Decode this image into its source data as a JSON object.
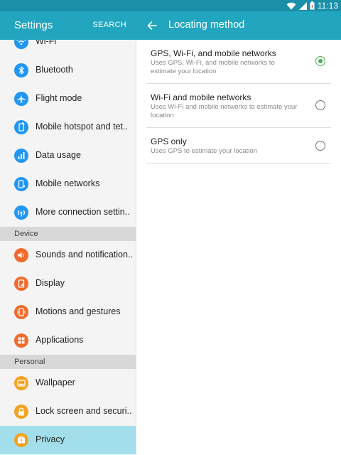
{
  "status_bar": {
    "time": "11:13"
  },
  "left_header": {
    "title": "Settings",
    "search_label": "SEARCH"
  },
  "right_header": {
    "title": "Locating method"
  },
  "settings_list": [
    {
      "type": "item",
      "label": "Wi-Fi",
      "icon": "wifi-icon",
      "color": "#2196f3"
    },
    {
      "type": "item",
      "label": "Bluetooth",
      "icon": "bluetooth-icon",
      "color": "#2196f3"
    },
    {
      "type": "item",
      "label": "Flight mode",
      "icon": "airplane-icon",
      "color": "#2196f3"
    },
    {
      "type": "item",
      "label": "Mobile hotspot and tet..",
      "icon": "hotspot-icon",
      "color": "#2196f3"
    },
    {
      "type": "item",
      "label": "Data usage",
      "icon": "data-usage-icon",
      "color": "#2196f3"
    },
    {
      "type": "item",
      "label": "Mobile networks",
      "icon": "mobile-networks-icon",
      "color": "#2196f3"
    },
    {
      "type": "item",
      "label": "More connection settin..",
      "icon": "more-connections-icon",
      "color": "#2196f3"
    },
    {
      "type": "header",
      "label": "Device"
    },
    {
      "type": "item",
      "label": "Sounds and notification..",
      "icon": "sound-icon",
      "color": "#ef6c2e"
    },
    {
      "type": "item",
      "label": "Display",
      "icon": "display-icon",
      "color": "#ef6c2e"
    },
    {
      "type": "item",
      "label": "Motions and gestures",
      "icon": "motions-icon",
      "color": "#ef6c2e"
    },
    {
      "type": "item",
      "label": "Applications",
      "icon": "applications-icon",
      "color": "#ef6c2e"
    },
    {
      "type": "header",
      "label": "Personal"
    },
    {
      "type": "item",
      "label": "Wallpaper",
      "icon": "wallpaper-icon",
      "color": "#f3a321"
    },
    {
      "type": "item",
      "label": "Lock screen and securi..",
      "icon": "lock-icon",
      "color": "#f3a321"
    },
    {
      "type": "item",
      "label": "Privacy",
      "icon": "privacy-icon",
      "color": "#f3a321",
      "selected": true
    }
  ],
  "locating_options": [
    {
      "title": "GPS, Wi-Fi, and mobile networks",
      "description": "Uses GPS, Wi-Fi, and mobile networks to estimate your location",
      "selected": true
    },
    {
      "title": "Wi-Fi and mobile networks",
      "description": "Uses Wi-Fi and mobile networks to estimate your location",
      "selected": false
    },
    {
      "title": "GPS only",
      "description": "Uses GPS to estimate your location",
      "selected": false
    }
  ],
  "colors": {
    "status_bar": "#1a8fa8",
    "action_bar": "#22a6c0",
    "selected_row": "#a3dfea",
    "radio_on": "#4caf50"
  }
}
